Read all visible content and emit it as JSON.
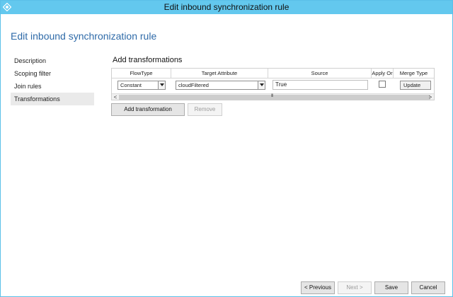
{
  "window": {
    "title": "Edit inbound synchronization rule"
  },
  "page": {
    "title": "Edit inbound synchronization rule"
  },
  "nav": {
    "items": [
      {
        "label": "Description",
        "active": false
      },
      {
        "label": "Scoping filter",
        "active": false
      },
      {
        "label": "Join rules",
        "active": false
      },
      {
        "label": "Transformations",
        "active": true
      }
    ]
  },
  "section": {
    "title": "Add transformations"
  },
  "grid": {
    "columns": [
      "FlowType",
      "Target Attribute",
      "Source",
      "Apply Or",
      "Merge Type"
    ],
    "rows": [
      {
        "flow_type": "Constant",
        "target_attribute": "cloudFiltered",
        "source": "True",
        "apply_once": false,
        "merge_type": "Update"
      }
    ],
    "scroll_left": "<",
    "scroll_right": ">",
    "scroll_grip": "III"
  },
  "actions": {
    "add_transformation": "Add transformation",
    "remove": "Remove"
  },
  "footer": {
    "previous": "< Previous",
    "next": "Next >",
    "save": "Save",
    "cancel": "Cancel"
  },
  "colors": {
    "titlebar": "#63c8ee",
    "page_title": "#2e6aa8",
    "nav_active": "#eaeaea"
  }
}
